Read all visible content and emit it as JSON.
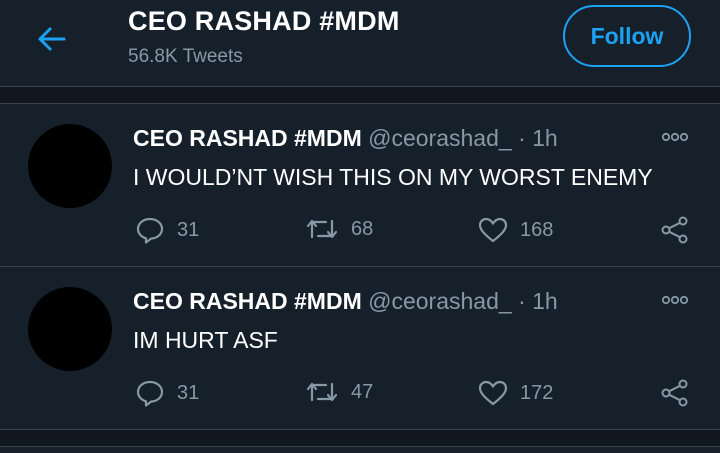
{
  "header": {
    "title": "CEO RASHAD #MDM",
    "subtitle": "56.8K Tweets",
    "follow_label": "Follow"
  },
  "tweets": [
    {
      "name": "CEO RASHAD #MDM",
      "handle": "@ceorashad_",
      "time": " · 1h",
      "text": "I WOULD’NT WISH THIS ON MY WORST ENEMY",
      "replies": "31",
      "retweets": "68",
      "likes": "168"
    },
    {
      "name": "CEO RASHAD #MDM",
      "handle": "@ceorashad_",
      "time": " · 1h",
      "text": "IM HURT ASF",
      "replies": "31",
      "retweets": "47",
      "likes": "172"
    }
  ],
  "colors": {
    "background": "#15202b",
    "accent": "#1da1f2",
    "muted": "#8899a6",
    "divider": "#38444d"
  }
}
